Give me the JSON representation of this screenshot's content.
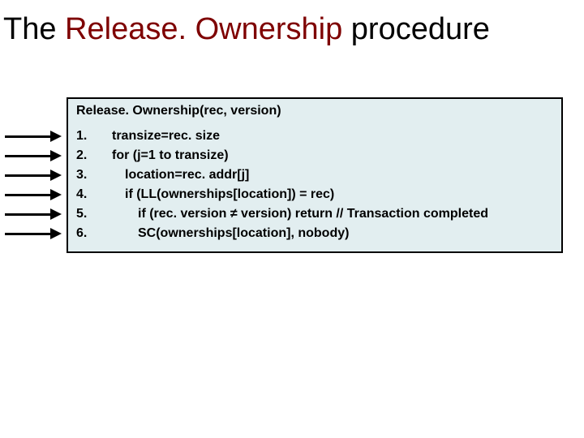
{
  "title": {
    "prefix": "The ",
    "keyword": "Release. Ownership",
    "suffix": " procedure"
  },
  "codebox": {
    "signature": "Release. Ownership(rec, version)",
    "lines": [
      {
        "n": "1.",
        "indent": 1,
        "text": "transize=rec. size"
      },
      {
        "n": "2.",
        "indent": 1,
        "text": "for (j=1 to transize)"
      },
      {
        "n": "3.",
        "indent": 2,
        "text": "location=rec. addr[j]"
      },
      {
        "n": "4.",
        "indent": 2,
        "text": "if (LL(ownerships[location]) = rec)"
      },
      {
        "n": "5.",
        "indent": 3,
        "text": "if (rec. version ≠ version) return // Transaction completed"
      },
      {
        "n": "6.",
        "indent": 3,
        "text": "SC(ownerships[location], nobody)"
      }
    ]
  },
  "arrows": {
    "count": 6,
    "name": "arrow-right-icon"
  }
}
